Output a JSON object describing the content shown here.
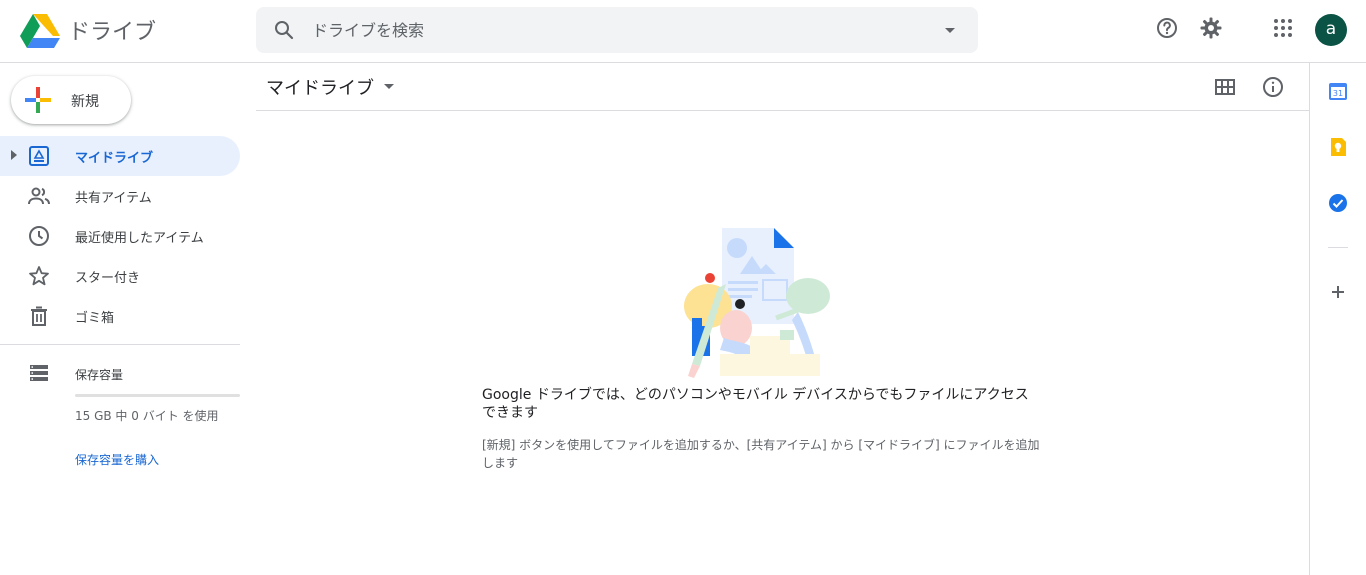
{
  "header": {
    "app_title": "ドライブ",
    "search_placeholder": "ドライブを検索",
    "icons": [
      "help-icon",
      "settings-icon",
      "apps-grid-icon"
    ],
    "avatar_letter": "a",
    "avatar_color": "#0b5345"
  },
  "sidebar": {
    "new_label": "新規",
    "items": [
      {
        "label": "マイドライブ",
        "icon": "my-drive-icon",
        "active": true
      },
      {
        "label": "共有アイテム",
        "icon": "shared-people-icon",
        "active": false
      },
      {
        "label": "最近使用したアイテム",
        "icon": "clock-icon",
        "active": false
      },
      {
        "label": "スター付き",
        "icon": "star-icon",
        "active": false
      },
      {
        "label": "ゴミ箱",
        "icon": "trash-icon",
        "active": false
      }
    ],
    "storage": {
      "label": "保存容量",
      "usage_text": "15 GB 中 0 バイト を使用",
      "used_fraction": 0,
      "buy_label": "保存容量を購入"
    }
  },
  "main": {
    "title": "マイドライブ",
    "empty_state": {
      "title": "Google ドライブでは、どのパソコンやモバイル デバイスからでもファイルにアクセスできます",
      "description": "[新規] ボタンを使用してファイルを追加するか、[共有アイテム] から [マイドライブ] にファイルを追加します"
    }
  },
  "colors": {
    "accent": "#1a73e8",
    "active_bg": "#e8f0fe",
    "active_text": "#1967d2"
  }
}
